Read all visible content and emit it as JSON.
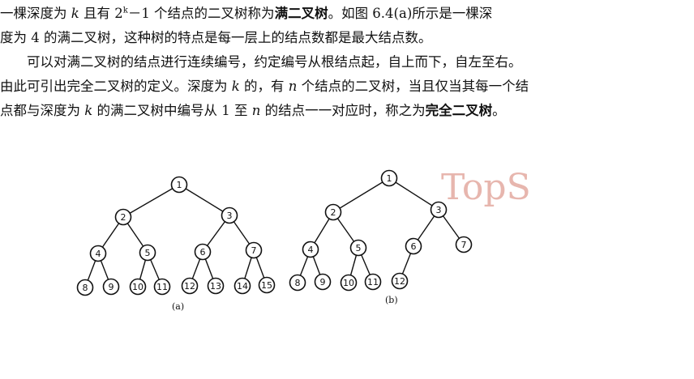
{
  "paragraph1": {
    "l1_a": "一棵深度为",
    "l1_k": "k",
    "l1_b": "且有 2",
    "l1_sup": "k",
    "l1_c": "－1 个结点的二叉树称为",
    "l1_bold": "满二叉树",
    "l1_d": "。如图 6.4(a)所示是一棵深",
    "l2": "度为 4 的满二叉树，这种树的特点是每一层上的结点数都是最大结点数。"
  },
  "paragraph2": {
    "l3": "可以对满二叉树的结点进行连续编号，约定编号从根结点起，自上而下，自左至右。",
    "l4_a": "由此可引出完全二叉树的定义。深度为",
    "l4_k": "k",
    "l4_b": "的，有",
    "l4_n": "n",
    "l4_c": "个结点的二叉树，当且仅当其每一个结",
    "l5_a": "点都与深度为",
    "l5_k": "k",
    "l5_b": "的满二叉树中编号从 1 至",
    "l5_n": "n",
    "l5_c": "的结点一一对应时，称之为",
    "l5_bold": "完全二叉树",
    "l5_d": "。"
  },
  "watermark": {
    "text": "TopS",
    "color": "#e7b6ae"
  },
  "figure": {
    "tree_a": {
      "caption": "(a)",
      "nodes": [
        {
          "id": 1,
          "label": "1"
        },
        {
          "id": 2,
          "label": "2"
        },
        {
          "id": 3,
          "label": "3"
        },
        {
          "id": 4,
          "label": "4"
        },
        {
          "id": 5,
          "label": "5"
        },
        {
          "id": 6,
          "label": "6"
        },
        {
          "id": 7,
          "label": "7"
        },
        {
          "id": 8,
          "label": "8"
        },
        {
          "id": 9,
          "label": "9"
        },
        {
          "id": 10,
          "label": "10"
        },
        {
          "id": 11,
          "label": "11"
        },
        {
          "id": 12,
          "label": "12"
        },
        {
          "id": 13,
          "label": "13"
        },
        {
          "id": 14,
          "label": "14"
        },
        {
          "id": 15,
          "label": "15"
        }
      ]
    },
    "tree_b": {
      "caption": "(b)",
      "nodes": [
        {
          "id": 1,
          "label": "1"
        },
        {
          "id": 2,
          "label": "2"
        },
        {
          "id": 3,
          "label": "3"
        },
        {
          "id": 4,
          "label": "4"
        },
        {
          "id": 5,
          "label": "5"
        },
        {
          "id": 6,
          "label": "6"
        },
        {
          "id": 7,
          "label": "7"
        },
        {
          "id": 8,
          "label": "8"
        },
        {
          "id": 9,
          "label": "9"
        },
        {
          "id": 10,
          "label": "10"
        },
        {
          "id": 11,
          "label": "11"
        },
        {
          "id": 12,
          "label": "12"
        }
      ]
    }
  }
}
